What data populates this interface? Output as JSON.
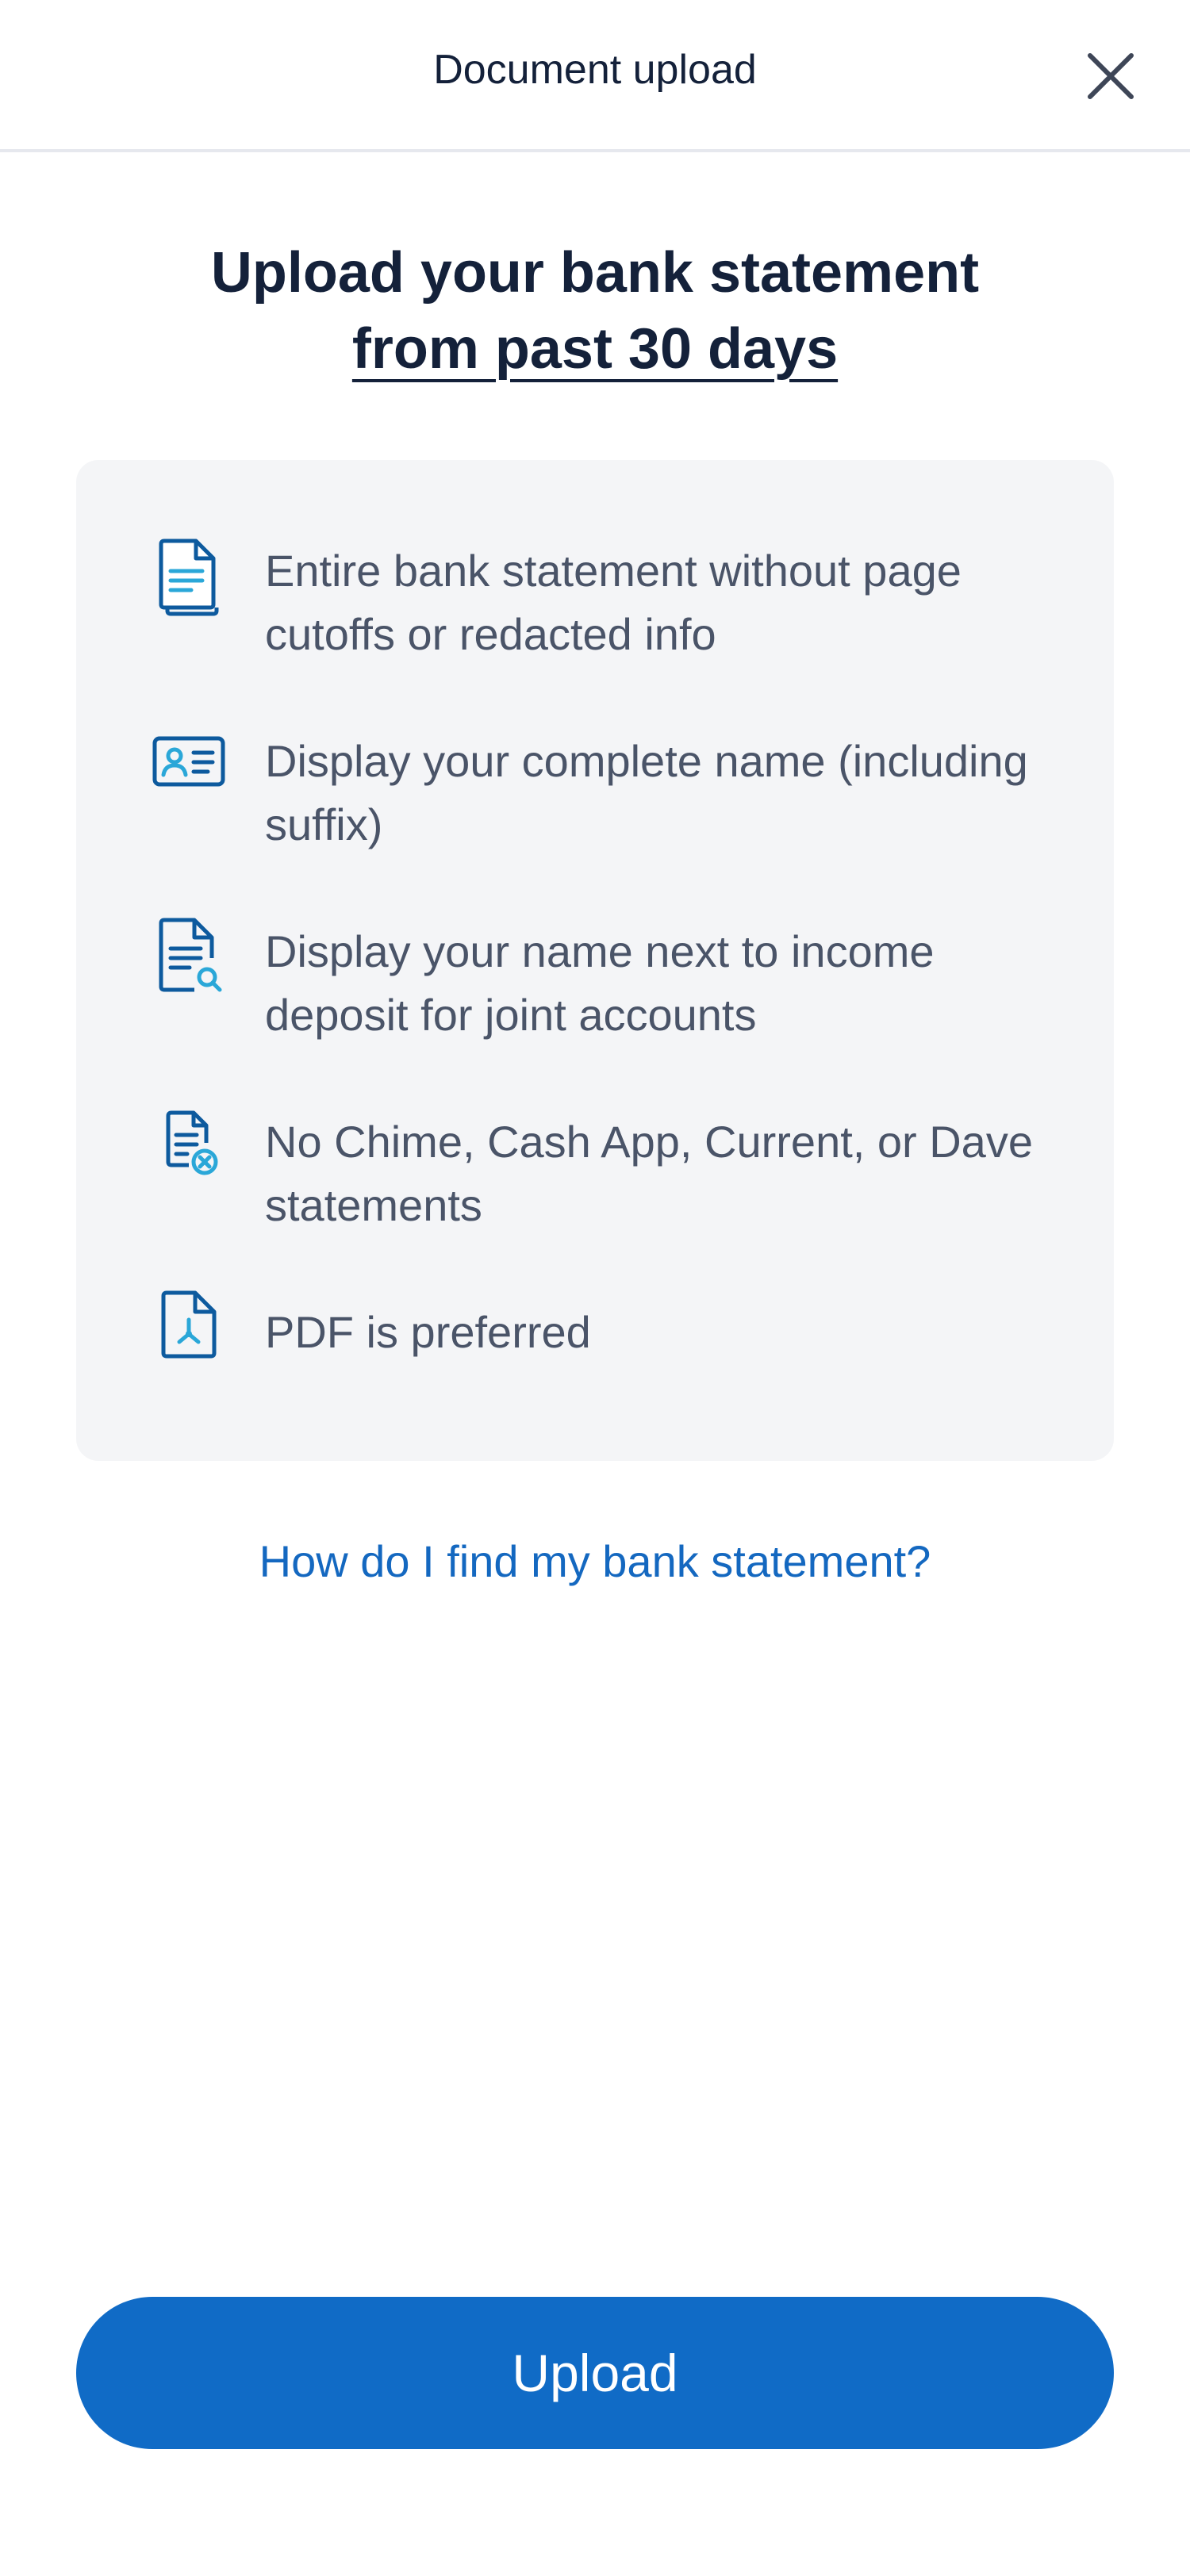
{
  "header": {
    "title": "Document upload",
    "close_icon": "close-icon"
  },
  "headline": {
    "line1": "Upload your bank statement",
    "line2": "from past 30 days"
  },
  "requirements": [
    {
      "icon": "documents-icon",
      "text": "Entire bank statement without page cutoffs or redacted info"
    },
    {
      "icon": "id-card-icon",
      "text": "Display your complete name (including suffix)"
    },
    {
      "icon": "document-search-icon",
      "text": "Display your name next to income deposit for joint accounts"
    },
    {
      "icon": "document-cancel-icon",
      "text": "No Chime, Cash App, Current, or Dave statements"
    },
    {
      "icon": "pdf-icon",
      "text": "PDF is preferred"
    }
  ],
  "help_link": "How do I find my bank statement?",
  "upload_button": "Upload",
  "colors": {
    "primary": "#106bc6",
    "icon_dark": "#0d5a9e",
    "icon_accent": "#2aa7d8",
    "text_dark": "#14213a",
    "text_muted": "#4a5468",
    "card_bg": "#f4f5f7"
  }
}
